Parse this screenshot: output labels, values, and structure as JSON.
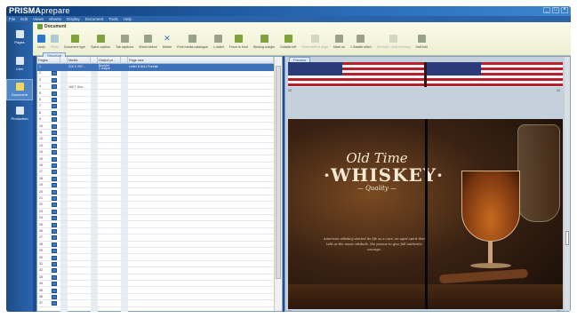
{
  "app": {
    "title_bold": "PRISMA",
    "title_light": "prepare",
    "window_controls": [
      "_",
      "□",
      "×"
    ]
  },
  "menu": [
    "File",
    "Edit",
    "Views",
    "Sheets",
    "Display",
    "Document",
    "Tools",
    "Help"
  ],
  "ribbon": {
    "tab_label": "Document",
    "tools": [
      {
        "label": "Undo",
        "icon": "undo-icon",
        "enabled": true
      },
      {
        "label": "Redo",
        "icon": "redo-icon",
        "enabled": false
      },
      {
        "label": "Document type",
        "icon": "document-type-icon",
        "enabled": true
      },
      {
        "label": "Spine caption",
        "icon": "spine-caption-icon",
        "enabled": true
      },
      {
        "label": "Tab captions",
        "icon": "tab-captions-icon",
        "enabled": true
      },
      {
        "label": "Sheet before",
        "icon": "sheet-before-icon",
        "enabled": true
      },
      {
        "label": "Delete",
        "icon": "delete-icon",
        "enabled": true
      },
      {
        "label": "Print media catalogue",
        "icon": "print-media-icon",
        "enabled": true
      },
      {
        "label": "1-sided",
        "icon": "one-sided-icon",
        "enabled": true
      },
      {
        "label": "Force to front",
        "icon": "force-front-icon",
        "enabled": true
      },
      {
        "label": "Binding margin",
        "icon": "binding-margin-icon",
        "enabled": true
      },
      {
        "label": "Outside left",
        "icon": "outside-left-icon",
        "enabled": true
      },
      {
        "label": "Sheet shift or align",
        "icon": "sheet-shift-icon",
        "enabled": false
      },
      {
        "label": "Mark on",
        "icon": "mark-on-icon",
        "enabled": true
      },
      {
        "label": "1 Saddle stitch",
        "icon": "saddle-stitch-icon",
        "enabled": true
      },
      {
        "label": "1st Hole / Limit finishing",
        "icon": "hole-limit-icon",
        "enabled": false
      },
      {
        "label": "Half-fold",
        "icon": "half-fold-icon",
        "enabled": true
      }
    ]
  },
  "leftnav": [
    {
      "label": "Pages",
      "active": false
    },
    {
      "label": "Inlet",
      "active": false
    },
    {
      "label": "Document",
      "active": true
    },
    {
      "label": "Production",
      "active": false
    }
  ],
  "structure": {
    "tab_label": "Structure",
    "columns": [
      "Pages",
      "",
      "Media",
      "",
      "Output pr...",
      "",
      "Page size"
    ],
    "selected_row": {
      "num": "1",
      "media": "210 X 297...",
      "output": "Booklet",
      "output2": "1 output",
      "size": "Letter 8.5x11 Portrait"
    },
    "second_media": "160 T Gra...",
    "row_numbers": [
      "1",
      "2",
      "3",
      "4",
      "5",
      "6",
      "7",
      "8",
      "9",
      "10",
      "11",
      "12",
      "13",
      "14",
      "15",
      "16",
      "17",
      "18",
      "19",
      "20",
      "21",
      "22",
      "23",
      "24",
      "25",
      "26",
      "27",
      "28",
      "29",
      "30",
      "31",
      "32",
      "33",
      "34",
      "35",
      "36",
      "37"
    ]
  },
  "preview": {
    "tab_label": "Preview",
    "page_nums": {
      "top_left": "20",
      "top_right": "21",
      "mid_left": "22",
      "mid_right": "23"
    },
    "art": {
      "line1": "Old Time",
      "line2": "·WHISKEY·",
      "line3": "— Quality —",
      "quote": "American whiskey started its life as a cure, an aged spirit that told us the music attitude, the pursue to give full authentic courage."
    }
  },
  "colors": {
    "accent": "#1e4f8c",
    "selection": "#3d72b8",
    "ribbon_bg": "#fbfbe9"
  }
}
